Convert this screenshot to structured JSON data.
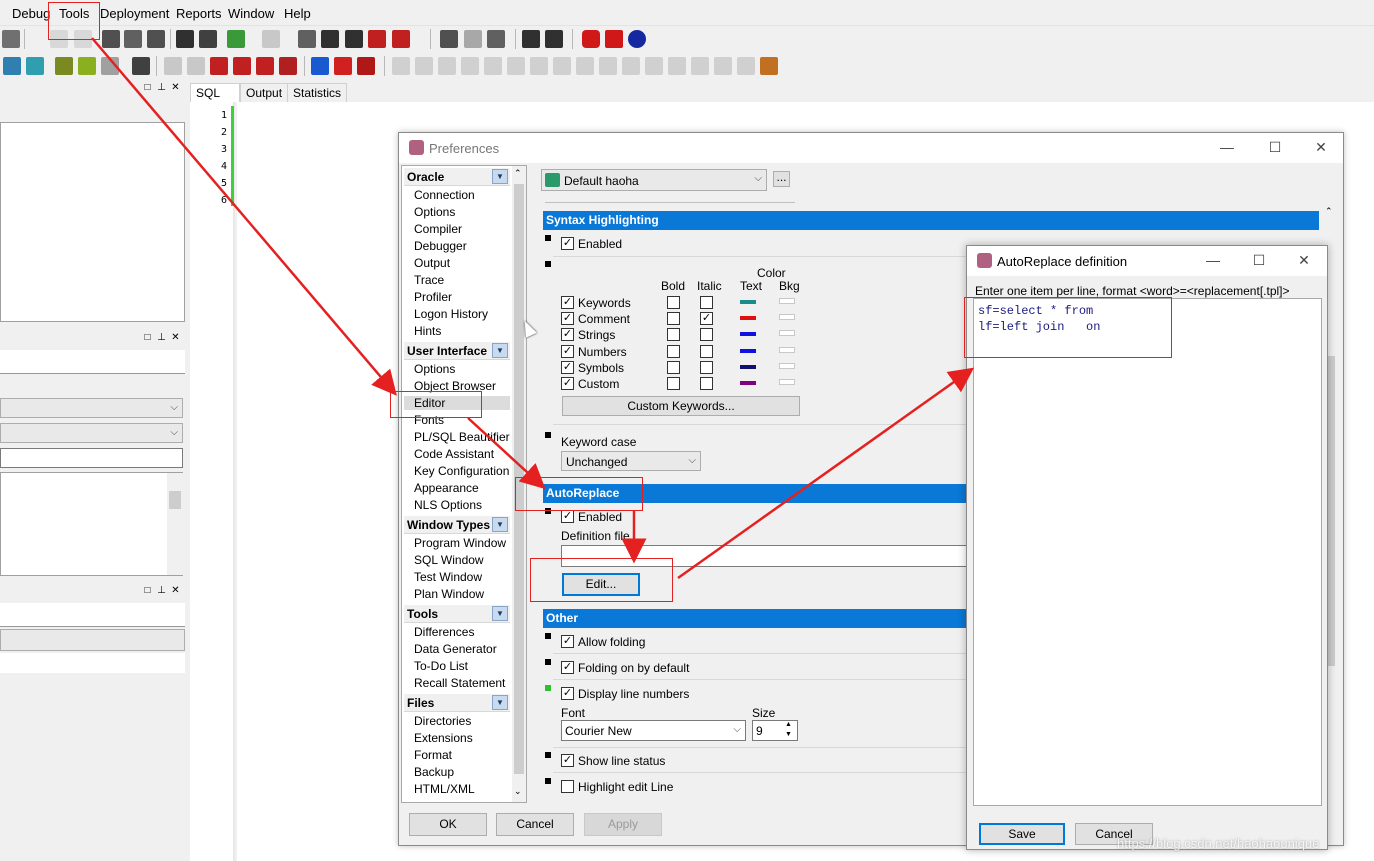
{
  "menu": {
    "items": [
      "Debug",
      "Tools",
      "Deployment",
      "Reports",
      "Window",
      "Help"
    ]
  },
  "editor": {
    "tabs": [
      "SQL",
      "Output",
      "Statistics"
    ],
    "line_numbers": [
      "1",
      "2",
      "3",
      "4",
      "5",
      "6"
    ]
  },
  "preferences": {
    "title": "Preferences",
    "profile": "Default haoha",
    "profile_more": "...",
    "nav": {
      "oracle": {
        "header": "Oracle",
        "items": [
          "Connection",
          "Options",
          "Compiler",
          "Debugger",
          "Output",
          "Trace",
          "Profiler",
          "Logon History",
          "Hints"
        ]
      },
      "user_interface": {
        "header": "User Interface",
        "items": [
          "Options",
          "Object Browser",
          "Editor",
          "Fonts",
          "PL/SQL Beautifier",
          "Code Assistant",
          "Key Configuration",
          "Appearance",
          "NLS Options"
        ]
      },
      "window_types": {
        "header": "Window Types",
        "items": [
          "Program Window",
          "SQL Window",
          "Test Window",
          "Plan Window"
        ]
      },
      "tools": {
        "header": "Tools",
        "items": [
          "Differences",
          "Data Generator",
          "To-Do List",
          "Recall Statement"
        ]
      },
      "files": {
        "header": "Files",
        "items": [
          "Directories",
          "Extensions",
          "Format",
          "Backup",
          "HTML/XML"
        ]
      }
    },
    "syntax": {
      "header": "Syntax Highlighting",
      "enabled_label": "Enabled",
      "col_bold": "Bold",
      "col_italic": "Italic",
      "col_color": "Color",
      "col_text": "Text",
      "col_bkg": "Bkg",
      "rows": [
        {
          "name": "Keywords",
          "bold": false,
          "italic": false,
          "color": "#1a8a8a"
        },
        {
          "name": "Comment",
          "bold": false,
          "italic": true,
          "color": "#e01010"
        },
        {
          "name": "Strings",
          "bold": false,
          "italic": false,
          "color": "#1010e0"
        },
        {
          "name": "Numbers",
          "bold": false,
          "italic": false,
          "color": "#1010e0"
        },
        {
          "name": "Symbols",
          "bold": false,
          "italic": false,
          "color": "#101070"
        },
        {
          "name": "Custom",
          "bold": false,
          "italic": false,
          "color": "#800080"
        }
      ],
      "custom_keywords_button": "Custom Keywords..."
    },
    "keyword_case": {
      "label": "Keyword case",
      "value": "Unchanged"
    },
    "autoreplace": {
      "header": "AutoReplace",
      "enabled_label": "Enabled",
      "definition_file_label": "Definition file",
      "edit_button": "Edit..."
    },
    "other": {
      "header": "Other",
      "allow_folding": "Allow folding",
      "folding_default": "Folding on by default",
      "display_line_numbers": "Display line numbers",
      "font_label": "Font",
      "font_value": "Courier New",
      "size_label": "Size",
      "size_value": "9",
      "show_line_status": "Show line status",
      "highlight_edit_line": "Highlight edit Line"
    },
    "buttons": {
      "ok": "OK",
      "cancel": "Cancel",
      "apply": "Apply"
    }
  },
  "autoreplace_dialog": {
    "title": "AutoReplace definition",
    "instruction": "Enter one item per line, format <word>=<replacement[.tpl]>",
    "lines": [
      "sf=select * from",
      "lf=left join   on"
    ],
    "save": "Save",
    "cancel": "Cancel"
  },
  "watermark": "https://blog.csdn.net/haohaounique",
  "colors": {
    "accent": "#0a78d7",
    "annotation": "#e52020"
  }
}
